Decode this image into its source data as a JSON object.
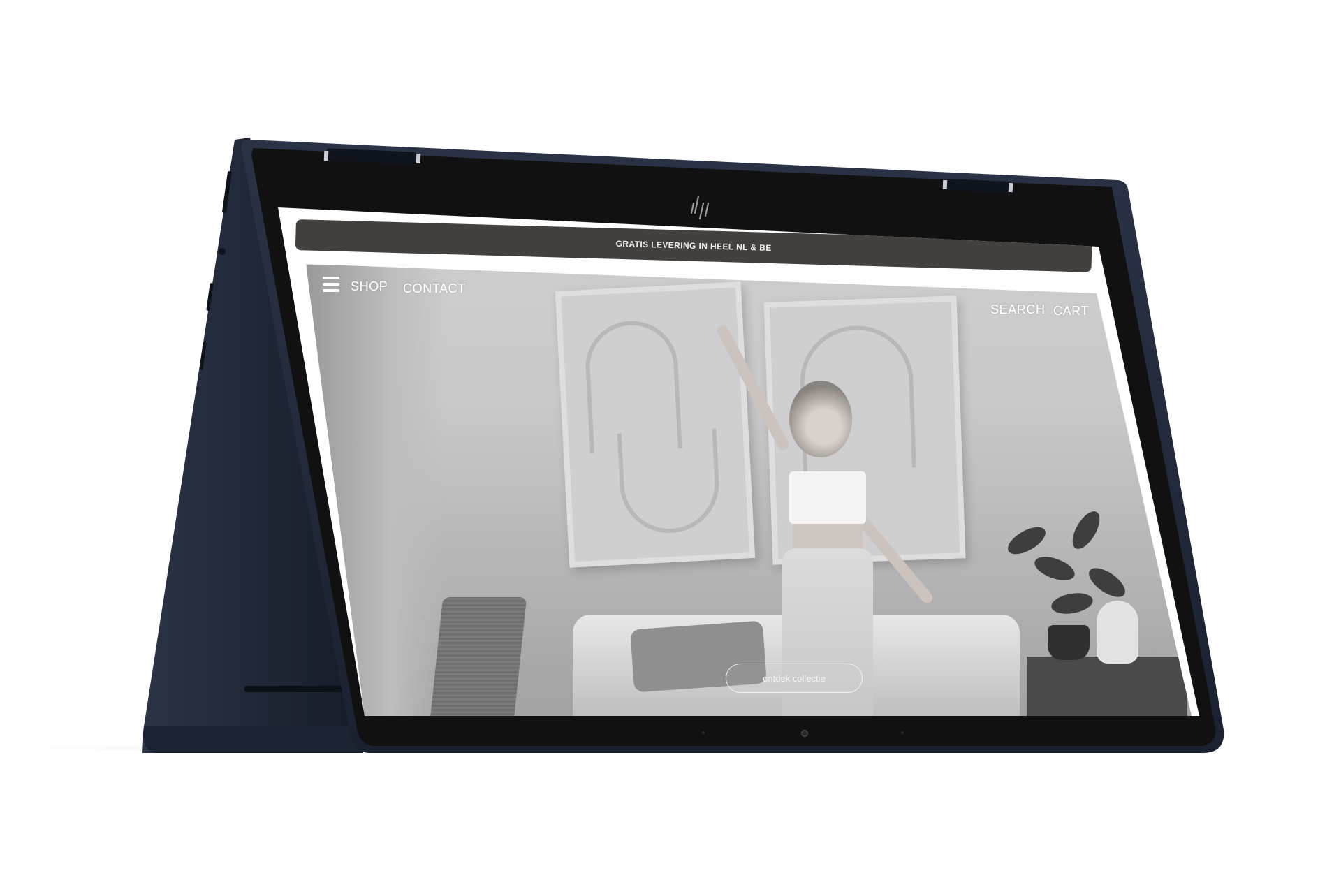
{
  "device": {
    "brand_logo_icon": "hp-logo-icon",
    "frame_color": "#1c2434",
    "bezel_color": "#111111"
  },
  "promo_bar": {
    "text": "GRATIS LEVERING IN HEEL NL & BE",
    "background": "#44403d"
  },
  "nav": {
    "menu_icon": "hamburger-menu-icon",
    "left_links": [
      "SHOP",
      "CONTACT"
    ],
    "right_links": [
      "SEARCH",
      "CART"
    ]
  },
  "hero": {
    "image": "black-and-white-woman-dancing-in-living-room",
    "cta_label": "ontdek collectie"
  }
}
